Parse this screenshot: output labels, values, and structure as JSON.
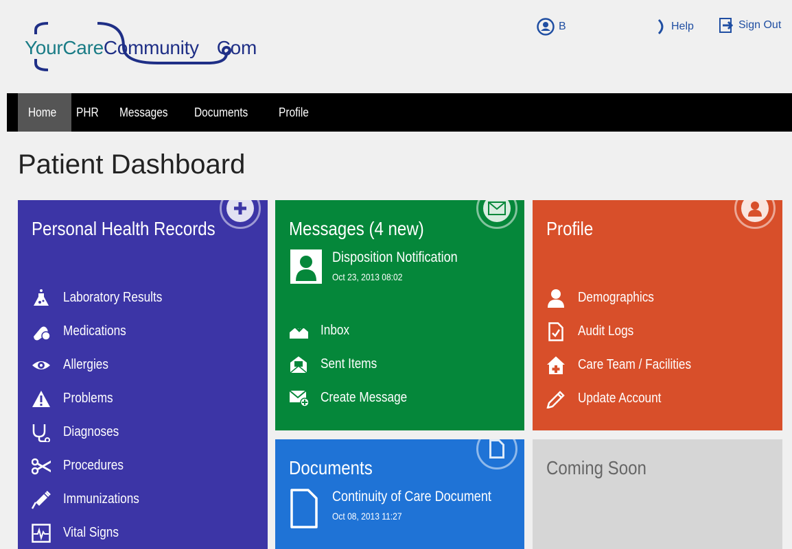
{
  "header": {
    "logo": {
      "part1": "YourCare",
      "part2": "Community",
      "part3": "Com"
    },
    "user_label": "B",
    "help_label": "Help",
    "signout_label": "Sign Out"
  },
  "nav": {
    "home": "Home",
    "phr": "PHR",
    "messages": "Messages",
    "documents": "Documents",
    "profile": "Profile"
  },
  "page": {
    "title": "Patient Dashboard"
  },
  "phr": {
    "title": "Personal Health Records",
    "items": [
      {
        "label": "Laboratory Results",
        "icon": "flask-icon"
      },
      {
        "label": "Medications",
        "icon": "pills-icon"
      },
      {
        "label": "Allergies",
        "icon": "eye-icon"
      },
      {
        "label": "Problems",
        "icon": "warning-icon"
      },
      {
        "label": "Diagnoses",
        "icon": "stethoscope-icon"
      },
      {
        "label": "Procedures",
        "icon": "scissors-icon"
      },
      {
        "label": "Immunizations",
        "icon": "syringe-icon"
      },
      {
        "label": "Vital Signs",
        "icon": "heartbeat-icon"
      }
    ]
  },
  "messages": {
    "title": "Messages  (4 new)",
    "latest": {
      "subject": "Disposition Notification",
      "date": "Oct 23, 2013 08:02"
    },
    "items": [
      {
        "label": "Inbox",
        "icon": "inbox-icon"
      },
      {
        "label": "Sent Items",
        "icon": "sent-icon"
      },
      {
        "label": "Create Message",
        "icon": "create-message-icon"
      }
    ]
  },
  "profile": {
    "title": "Profile",
    "items": [
      {
        "label": "Demographics",
        "icon": "person-icon"
      },
      {
        "label": "Audit Logs",
        "icon": "audit-icon"
      },
      {
        "label": "Care Team / Facilities",
        "icon": "hospital-icon"
      },
      {
        "label": "Update Account",
        "icon": "pencil-icon"
      }
    ]
  },
  "documents": {
    "title": "Documents",
    "latest": {
      "name": "Continuity of Care Document",
      "date": "Oct 08, 2013 11:27"
    }
  },
  "coming": {
    "title": "Coming Soon"
  },
  "colors": {
    "phr": "#3c35a6",
    "messages": "#05873a",
    "profile": "#d84f2a",
    "documents": "#1f73d6",
    "coming": "#d6d6d6",
    "nav": "#000000"
  }
}
